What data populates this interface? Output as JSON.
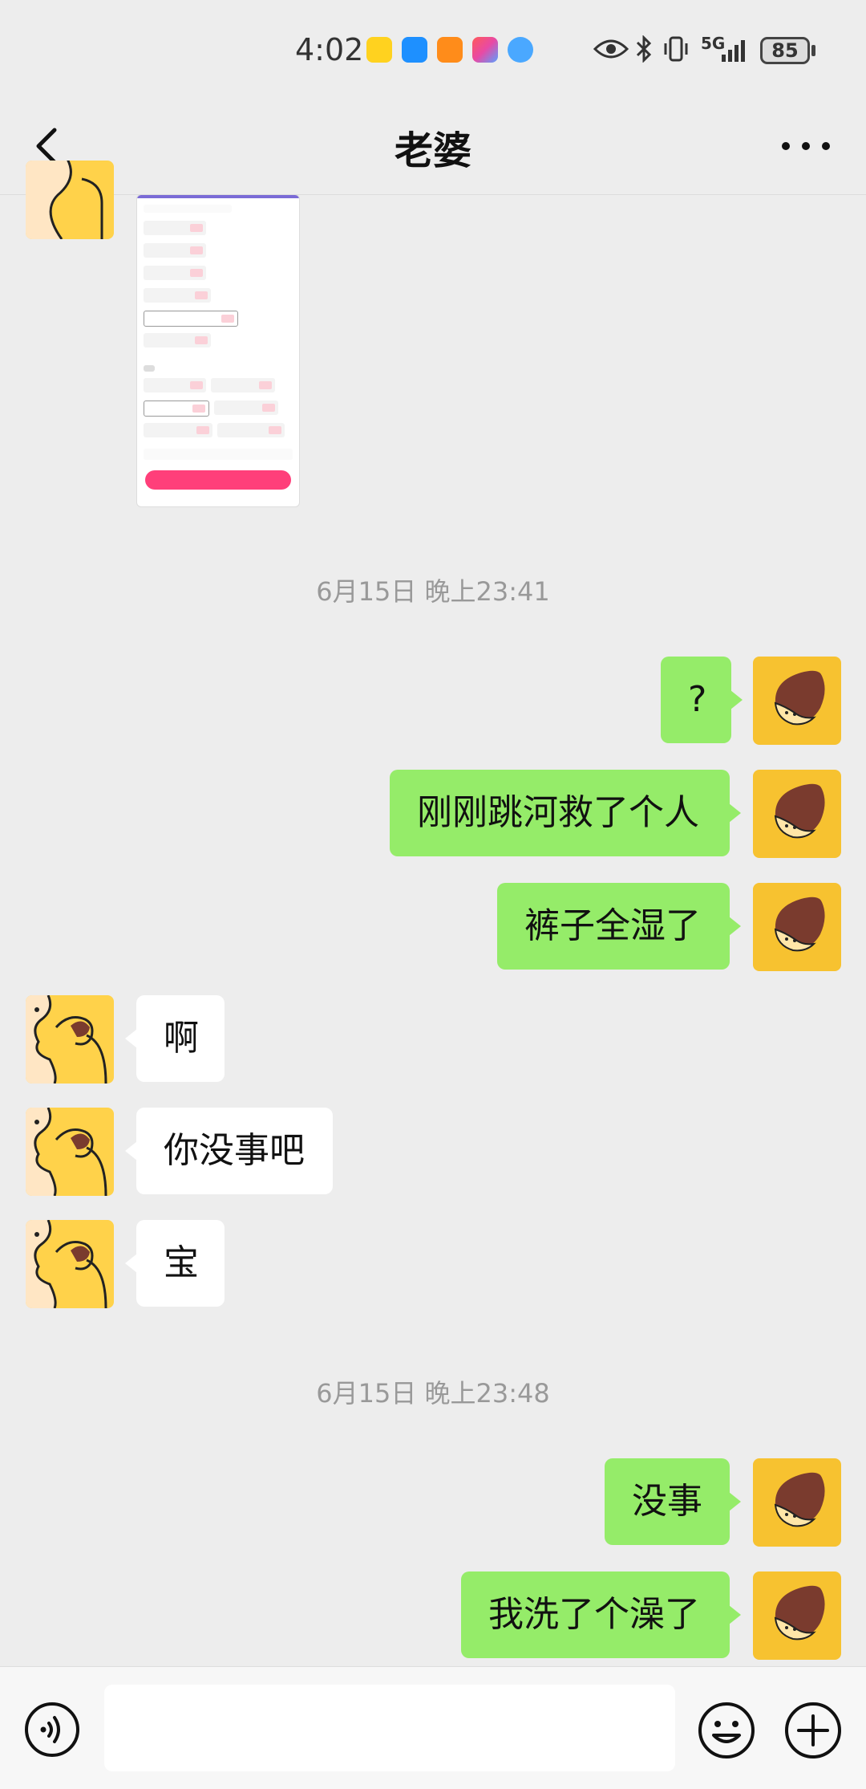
{
  "status_bar": {
    "time": "4:02",
    "network": "5G",
    "battery": "85",
    "app_icons": [
      {
        "name": "weibo-app-icon",
        "color": "#ffd21f"
      },
      {
        "name": "cloud-app-icon",
        "color": "#1e90ff"
      },
      {
        "name": "orange-app-icon",
        "color": "#ff8c1a"
      },
      {
        "name": "colorful-app-icon",
        "color": "#e84aa5"
      },
      {
        "name": "browser-app-icon",
        "color": "#4aa8ff"
      }
    ]
  },
  "header": {
    "title": "老婆",
    "back_icon": "chevron-left-icon",
    "more_icon": "more-dots-icon"
  },
  "chat": {
    "timestamps": [
      "6月15日 晚上23:41",
      "6月15日 晚上23:48"
    ],
    "messages": [
      {
        "sender": "me",
        "text": "?"
      },
      {
        "sender": "me",
        "text": "刚刚跳河救了个人"
      },
      {
        "sender": "me",
        "text": "裤子全湿了"
      },
      {
        "sender": "them",
        "text": "啊"
      },
      {
        "sender": "them",
        "text": "你没事吧"
      },
      {
        "sender": "them",
        "text": "宝"
      },
      {
        "sender": "me",
        "text": "没事"
      },
      {
        "sender": "me",
        "text": "我洗了个澡了"
      }
    ]
  },
  "input_bar": {
    "placeholder": "",
    "voice_icon": "voice-icon",
    "emoji_icon": "emoji-icon",
    "plus_icon": "plus-icon"
  },
  "colors": {
    "my_bubble": "#95ec69",
    "their_bubble": "#ffffff",
    "background": "#ededed",
    "my_avatar_bg": "#f7c230",
    "their_avatar_bg": "#ffd24a"
  }
}
